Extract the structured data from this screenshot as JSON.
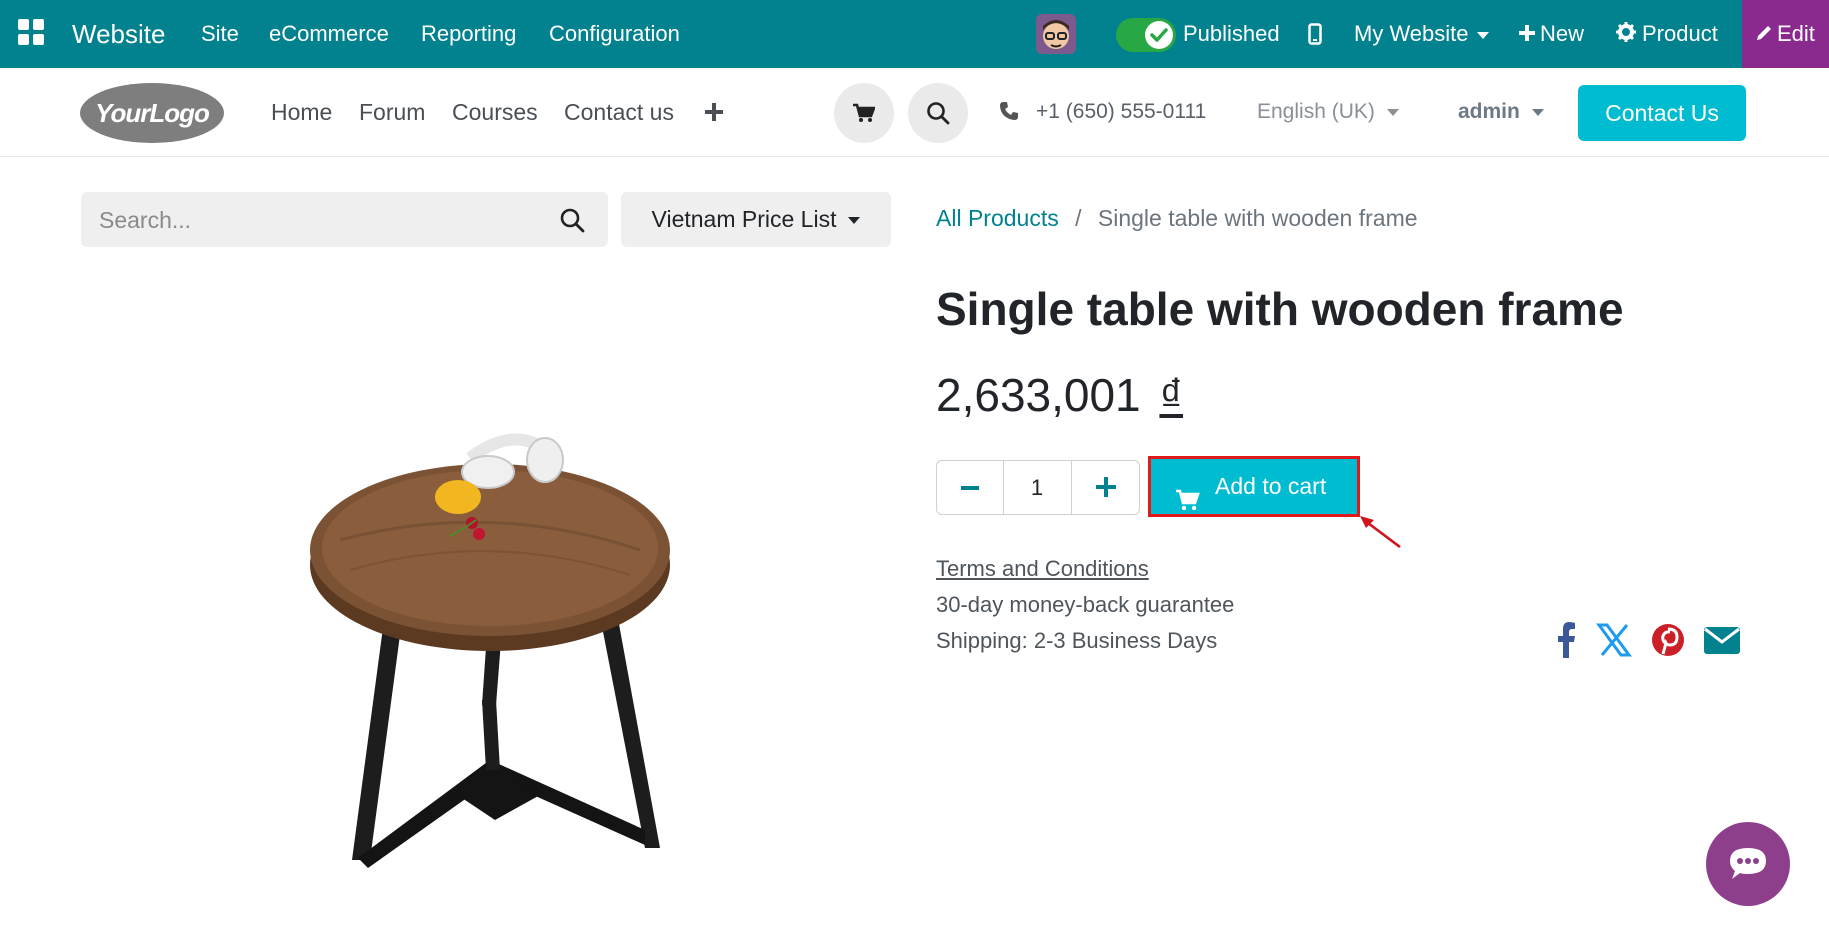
{
  "adminbar": {
    "app_title": "Website",
    "menu": [
      "Site",
      "eCommerce",
      "Reporting",
      "Configuration"
    ],
    "published_label": "Published",
    "website_label": "My Website",
    "new_label": "New",
    "product_label": "Product",
    "edit_label": "Edit"
  },
  "header": {
    "logo_text": "YourLogo",
    "nav": [
      "Home",
      "Forum",
      "Courses",
      "Contact us"
    ],
    "phone": "+1 (650) 555-0111",
    "language": "English (UK)",
    "user": "admin",
    "contact_button": "Contact Us"
  },
  "shop": {
    "search_placeholder": "Search...",
    "pricelist": "Vietnam Price List"
  },
  "breadcrumb": {
    "parent": "All Products",
    "separator": "/",
    "current": "Single table with wooden frame"
  },
  "product": {
    "name": "Single table with wooden frame",
    "price": "2,633,001",
    "currency": "₫",
    "quantity": "1",
    "add_to_cart": "Add to cart",
    "terms": "Terms and Conditions",
    "guarantee": "30-day money-back guarantee",
    "shipping": "Shipping: 2-3 Business Days"
  },
  "colors": {
    "adminbar": "#01828e",
    "accent": "#00bcd0",
    "edit": "#8a2a8e",
    "highlight": "#e0191b"
  },
  "icons": [
    "apps-icon",
    "toggle-check-icon",
    "mobile-icon",
    "plus-icon",
    "gear-icon",
    "pencil-icon",
    "cart-icon",
    "search-icon",
    "phone-icon",
    "minus-icon",
    "facebook-icon",
    "x-icon",
    "pinterest-icon",
    "email-icon",
    "chat-icon"
  ]
}
